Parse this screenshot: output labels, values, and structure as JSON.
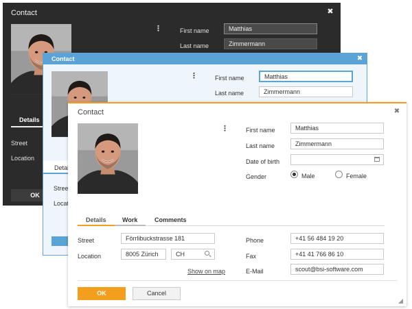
{
  "dialog_dark": {
    "title": "Contact",
    "close_glyph": "✖",
    "first_name_label": "First name",
    "first_name_value": "Matthias",
    "last_name_label": "Last name",
    "last_name_value": "Zimmermann",
    "tab_details": "Details",
    "street_label": "Street",
    "location_label": "Location",
    "ok_label": "OK"
  },
  "dialog_blue": {
    "title": "Contact",
    "close_glyph": "✖",
    "first_name_label": "First name",
    "first_name_value": "Matthias",
    "last_name_label": "Last name",
    "last_name_value": "Zimmermann",
    "tab_details": "Detai",
    "street_label": "Stree",
    "location_label": "Locati"
  },
  "dialog_main": {
    "title": "Contact",
    "close_glyph": "✖",
    "kebab_glyph": "⋮",
    "first_name_label": "First name",
    "first_name_value": "Matthias",
    "last_name_label": "Last name",
    "last_name_value": "Zimmermann",
    "dob_label": "Date of birth",
    "dob_value": "",
    "gender_label": "Gender",
    "gender_options": [
      "Male",
      "Female"
    ],
    "gender_selected": "Male",
    "tabs": [
      {
        "label": "Details",
        "active": true
      },
      {
        "label": "Work",
        "active": false
      },
      {
        "label": "Comments",
        "active": false
      }
    ],
    "street_label": "Street",
    "street_value": "Förrlibuckstrasse 181",
    "location_label": "Location",
    "zip_city_value": "8005 Zürich",
    "country_value": "CH",
    "show_on_map": "Show on map",
    "phone_label": "Phone",
    "phone_value": "+41 56 484 19 20",
    "fax_label": "Fax",
    "fax_value": "+41 41 766 86 10",
    "email_label": "E-Mail",
    "email_value": "scout@bsi-software.com",
    "ok_label": "OK",
    "cancel_label": "Cancel"
  },
  "colors": {
    "accent_orange": "#f49e1d",
    "header_blue": "#5aa3d6",
    "dark_bg": "#2b2b2b"
  },
  "icons": [
    "close-icon",
    "kebab-menu-icon",
    "calendar-icon",
    "search-icon",
    "resize-grip-icon",
    "person-photo"
  ]
}
